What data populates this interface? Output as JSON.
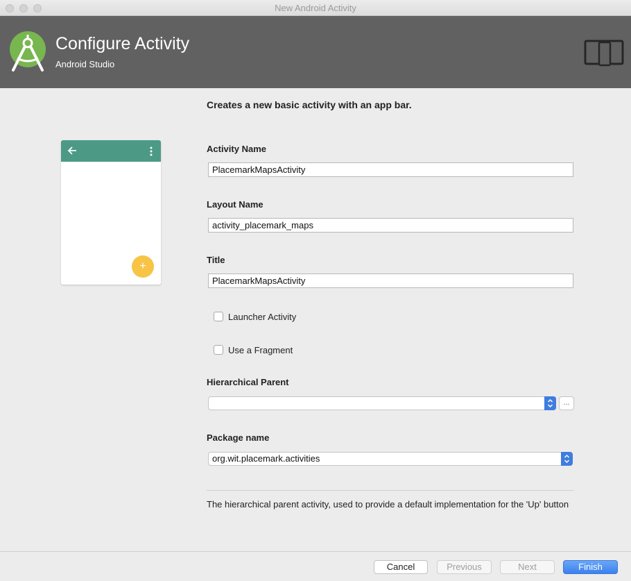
{
  "window": {
    "title": "New Android Activity"
  },
  "header": {
    "title": "Configure Activity",
    "subtitle": "Android Studio",
    "logo_icon": "android-studio-logo-icon",
    "device_icon": "tablet-phone-icon",
    "background_color": "#616161"
  },
  "description": "Creates a new basic activity with an app bar.",
  "preview": {
    "appbar_color": "#4c9a86",
    "fab_color": "#f7c445",
    "fab_symbol": "+",
    "back_icon": "arrow-back-icon",
    "menu_icon": "more-vert-icon"
  },
  "form": {
    "activity_name": {
      "label": "Activity Name",
      "value": "PlacemarkMapsActivity"
    },
    "layout_name": {
      "label": "Layout Name",
      "value": "activity_placemark_maps"
    },
    "title": {
      "label": "Title",
      "value": "PlacemarkMapsActivity"
    },
    "launcher_activity": {
      "label": "Launcher Activity",
      "checked": false
    },
    "use_fragment": {
      "label": "Use a Fragment",
      "checked": false
    },
    "hierarchical_parent": {
      "label": "Hierarchical Parent",
      "value": "",
      "browse_label": "..."
    },
    "package_name": {
      "label": "Package name",
      "value": "org.wit.placemark.activities"
    }
  },
  "help_text": "The hierarchical parent activity, used to provide a default implementation for the 'Up' button",
  "buttons": {
    "cancel": "Cancel",
    "previous": "Previous",
    "next": "Next",
    "finish": "Finish"
  },
  "accent_color": "#3b82ee"
}
